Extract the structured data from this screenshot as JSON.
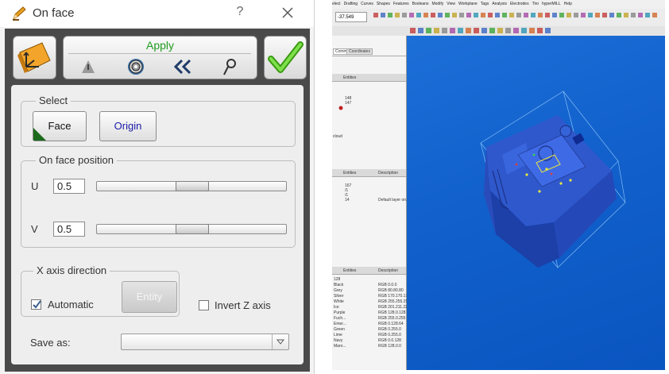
{
  "dialog": {
    "title": "On face",
    "help_label": "?",
    "apply_label": "Apply",
    "select_group": {
      "legend": "Select",
      "face_button": "Face",
      "origin_button": "Origin"
    },
    "position_group": {
      "legend": "On face position",
      "u_label": "U",
      "u_value": "0.5",
      "v_label": "V",
      "v_value": "0.5",
      "u_slider_fraction": 0.5,
      "v_slider_fraction": 0.5
    },
    "x_axis_group": {
      "legend": "X axis direction",
      "automatic_label": "Automatic",
      "automatic_checked": true,
      "entity_button": "Entity"
    },
    "invert_z": {
      "label": "Invert Z axis",
      "checked": false
    },
    "save_as": {
      "label": "Save as:",
      "value": ""
    },
    "colors": {
      "apply_green": "#1e9c1e",
      "origin_blue": "#1a1aa8",
      "ok_check_green": "#5fcf2a",
      "body_dark": "#4a4a4a"
    },
    "icons": [
      "pen-icon",
      "tool-icon",
      "warning-icon",
      "gear-icon",
      "double-chevron-left-icon",
      "magnifier-icon",
      "checkmark-icon",
      "close-icon"
    ]
  },
  "cad": {
    "menu_items": [
      "elect",
      "Drafting",
      "Curves",
      "Shapes",
      "Features",
      "Booleans",
      "Modify",
      "View",
      "Workplane",
      "Tags",
      "Analysis",
      "Electrodes",
      "Tiro",
      "hyperMILL",
      "Help"
    ],
    "coord_field": "-37.549",
    "tabs": [
      "Command",
      "Coordinates"
    ],
    "panel1_header": "Entities",
    "panel1_rows": [
      "148",
      "147"
    ],
    "panel1_side": [
      "cloud"
    ],
    "panel2_headers": [
      "Entities",
      "Description"
    ],
    "panel2_rows": [
      "167",
      "/1",
      "/1",
      "14"
    ],
    "panel2_desc": "Default layer on...",
    "panel3_headers": [
      "Entities",
      "Description"
    ],
    "panel3_rows": [
      {
        "name": "128",
        "desc": ""
      },
      {
        "name": "Black",
        "desc": "RGB 0.0.0"
      },
      {
        "name": "Grey",
        "desc": "RGB 80.80.80"
      },
      {
        "name": "Silver",
        "desc": "RGB 170.170.170"
      },
      {
        "name": "White",
        "desc": "RGB 255.255.255"
      },
      {
        "name": "Ice",
        "desc": "RGB 201.211.225"
      },
      {
        "name": "Purple",
        "desc": "RGB 128.0.128"
      },
      {
        "name": "Fuch...",
        "desc": "RGB 255.0.255"
      },
      {
        "name": "Emer...",
        "desc": "RGB 0.128.64"
      },
      {
        "name": "Green",
        "desc": "RGB 0.255.0"
      },
      {
        "name": "Lime",
        "desc": "RGB 0.255.0"
      },
      {
        "name": "Navy",
        "desc": "RGB 0.0.128"
      },
      {
        "name": "Maro...",
        "desc": "RGB 128.0.0"
      }
    ]
  }
}
